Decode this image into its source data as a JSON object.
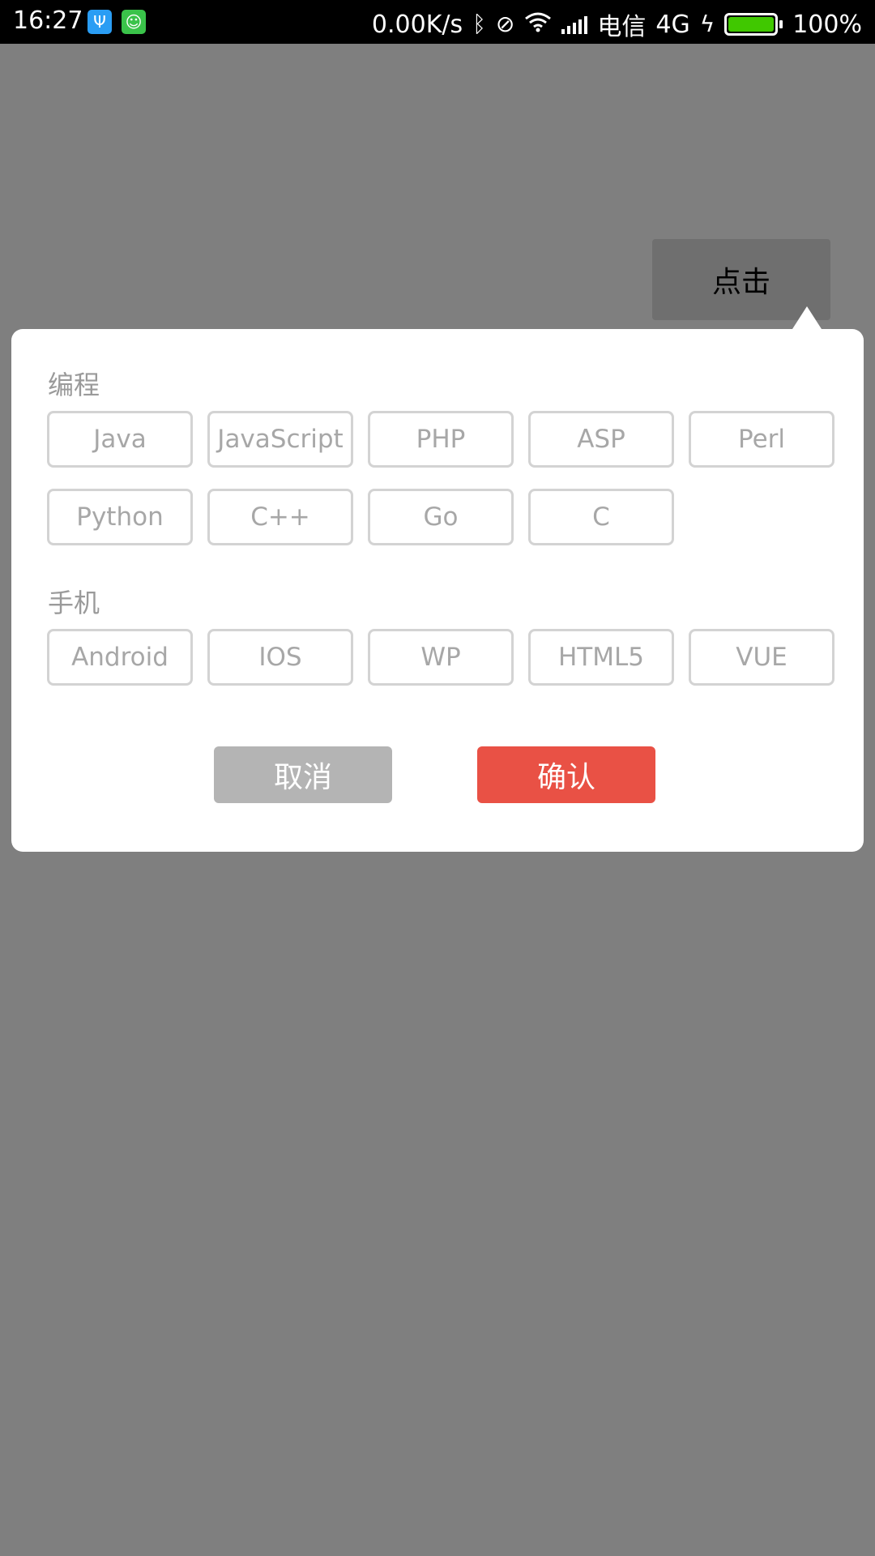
{
  "status_bar": {
    "time": "16:27",
    "net_speed": "0.00K/s",
    "carrier": "电信",
    "network": "4G",
    "battery_text": "100%",
    "battery_level": 1.0,
    "icons": [
      "usb-icon",
      "robot-icon",
      "bluetooth-icon",
      "vibrate-off-icon",
      "wifi-icon",
      "signal-icon",
      "charging-icon",
      "battery-icon"
    ]
  },
  "trigger": {
    "label": "点击"
  },
  "sections": [
    {
      "title": "编程",
      "tags": [
        "Java",
        "JavaScript",
        "PHP",
        "ASP",
        "Perl",
        "Python",
        "C++",
        "Go",
        "C"
      ]
    },
    {
      "title": "手机",
      "tags": [
        "Android",
        "IOS",
        "WP",
        "HTML5",
        "VUE"
      ]
    }
  ],
  "buttons": {
    "cancel": "取消",
    "confirm": "确认"
  },
  "colors": {
    "overlay": "#7f7f7f",
    "confirm": "#e95145",
    "cancel": "#b4b4b4",
    "tag_border": "#d3d3d3",
    "battery_fill": "#40c800"
  }
}
